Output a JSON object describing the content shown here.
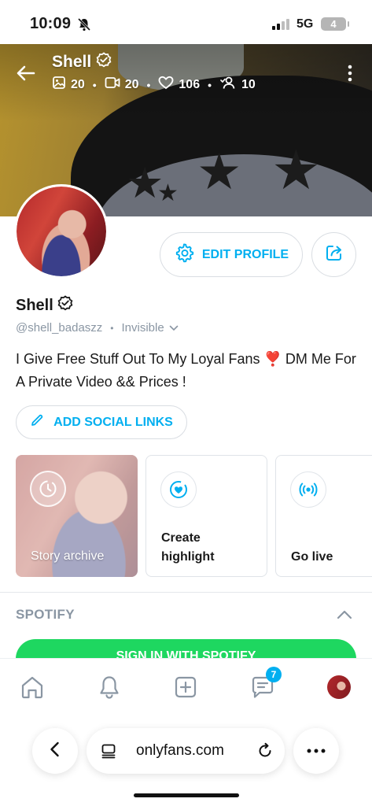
{
  "status_bar": {
    "time": "10:09",
    "network": "5G",
    "battery": "4",
    "icons": [
      "bell-slash-icon",
      "signal-icon"
    ]
  },
  "header": {
    "title": "Shell",
    "stats": {
      "photos": "20",
      "videos": "20",
      "likes": "106",
      "fans": "10"
    },
    "icons": [
      "back-arrow-icon",
      "verified-icon",
      "photo-icon",
      "video-icon",
      "heart-icon",
      "fans-icon",
      "more-vertical-icon"
    ]
  },
  "profile": {
    "edit_label": "EDIT PROFILE",
    "name": "Shell",
    "handle": "@shell_badaszz",
    "visibility": "Invisible",
    "bio_part1": "I Give Free Stuff Out To My Loyal Fans",
    "bio_heart": "❣️",
    "bio_part2": " DM Me For A Private Video && Prices !",
    "social_label": "ADD SOCIAL LINKS"
  },
  "cards": [
    {
      "label": "Story archive",
      "icon": "clock-icon"
    },
    {
      "label_line1": "Create",
      "label_line2": "highlight",
      "icon": "heart-badge-icon"
    },
    {
      "label": "Go live",
      "icon": "broadcast-icon"
    }
  ],
  "spotify": {
    "title": "SPOTIFY",
    "button_label": "SIGN IN WITH SPOTIFY"
  },
  "bottom_nav": {
    "messages_badge": "7",
    "icons": [
      "home-icon",
      "notifications-icon",
      "add-post-icon",
      "messages-icon",
      "profile-avatar"
    ]
  },
  "browser": {
    "domain": "onlyfans.com",
    "icons": [
      "back-icon",
      "tabs-icon",
      "reload-icon",
      "more-icon"
    ]
  },
  "colors": {
    "accent": "#00aff0",
    "spotify_green": "#1ed760",
    "muted_text": "#8a96a3"
  }
}
